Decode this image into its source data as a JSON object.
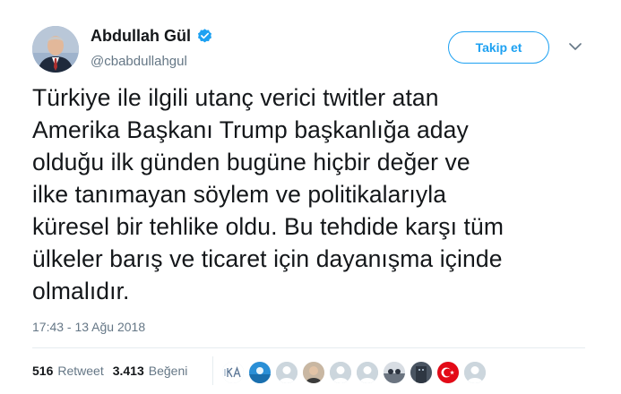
{
  "user": {
    "display_name": "Abdullah Gül",
    "handle": "@cbabdullahgul",
    "verified": true
  },
  "follow_button": {
    "label": "Takip et"
  },
  "tweet": {
    "lines": [
      "Türkiye ile ilgili utanç verici twitler atan",
      "Amerika Başkanı Trump başkanlığa aday",
      "olduğu ilk günden bugüne hiçbir değer ve",
      "ilke tanımayan söylem ve politikalarıyla",
      "küresel bir tehlike oldu. Bu tehdide karşı tüm",
      "ülkeler barış ve ticaret için dayanışma içinde",
      "olmalıdır."
    ],
    "timestamp": "17:43 - 13 Ağu 2018"
  },
  "stats": {
    "retweets_count": "516",
    "retweets_label": "Retweet",
    "likes_count": "3.413",
    "likes_label": "Beğeni"
  },
  "likers": [
    {
      "icon": "ka-logo-avatar"
    },
    {
      "icon": "pool-photo-avatar"
    },
    {
      "icon": "default-avatar"
    },
    {
      "icon": "person-photo-avatar"
    },
    {
      "icon": "default-avatar"
    },
    {
      "icon": "default-avatar"
    },
    {
      "icon": "group-photo-avatar"
    },
    {
      "icon": "building-photo-avatar"
    },
    {
      "icon": "turkish-flag-avatar"
    },
    {
      "icon": "default-avatar"
    }
  ],
  "colors": {
    "accent": "#1da1f2",
    "text": "#14171a",
    "secondary": "#657786",
    "divider": "#e6ecf0"
  }
}
